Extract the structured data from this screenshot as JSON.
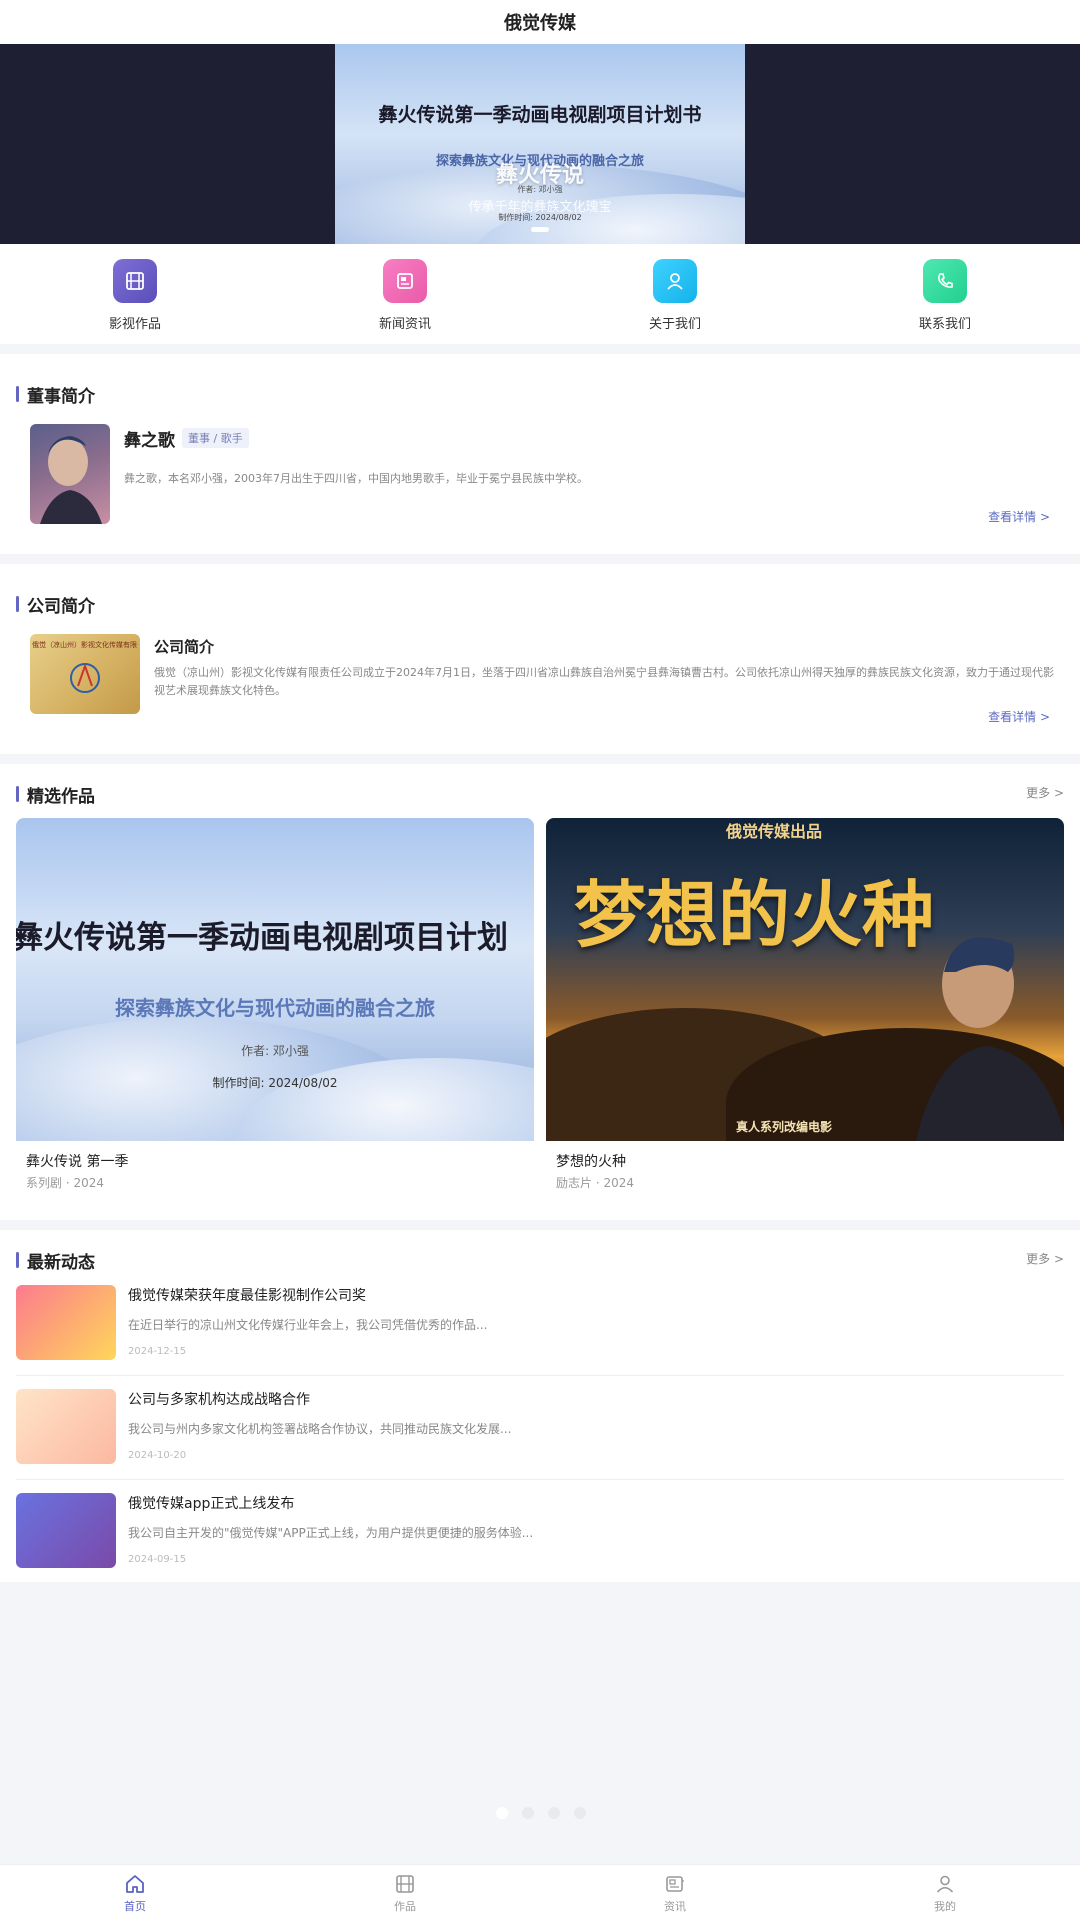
{
  "header": {
    "title": "俄觉传媒"
  },
  "banner": {
    "slide_title": "彝火传说第一季动画电视剧项目计划书",
    "slide_subtitle": "探索彝族文化与现代动画的融合之旅",
    "overlay_title": "彝火传说",
    "overlay_subtitle": "传承千年的彝族文化瑰宝",
    "author": "作者: 邓小强",
    "date": "制作时间: 2024/08/02"
  },
  "quicknav": [
    {
      "label": "影视作品",
      "icon": "film-icon",
      "color": "#6a5fc8"
    },
    {
      "label": "新闻资讯",
      "icon": "news-icon",
      "color": "#f06ab5"
    },
    {
      "label": "关于我们",
      "icon": "user-icon",
      "color": "#23c2f2"
    },
    {
      "label": "联系我们",
      "icon": "phone-icon",
      "color": "#35dca0"
    }
  ],
  "chairman": {
    "section_title": "董事简介",
    "name": "彝之歌",
    "tag": "董事 / 歌手",
    "bio": "彝之歌，本名邓小强，2003年7月出生于四川省，中国内地男歌手，毕业于冕宁县民族中学校。",
    "detail_link": "查看详情 >"
  },
  "company": {
    "section_title": "公司简介",
    "name": "公司简介",
    "logo_text": "俄觉（凉山州）影视文化传媒有限公司",
    "description": "俄觉（凉山州）影视文化传媒有限责任公司成立于2024年7月1日，坐落于四川省凉山彝族自治州冕宁县彝海镇曹古村。公司依托凉山州得天独厚的彝族民族文化资源，致力于通过现代影视艺术展现彝族文化特色。",
    "detail_link": "查看详情 >"
  },
  "works": {
    "section_title": "精选作品",
    "more": "更多 >",
    "items": [
      {
        "title": "彝火传说 第一季",
        "meta": "系列剧 · 2024",
        "poster_title": "彝火传说第一季动画电视剧项目计划",
        "poster_subtitle": "探索彝族文化与现代动画的融合之旅",
        "poster_author": "作者: 邓小强",
        "poster_date": "制作时间: 2024/08/02"
      },
      {
        "title": "梦想的火种",
        "meta": "励志片 · 2024",
        "poster_top": "俄觉传媒出品",
        "poster_title": "梦想的火种",
        "poster_bottom": "真人系列改编电影"
      }
    ]
  },
  "news": {
    "section_title": "最新动态",
    "more": "更多 >",
    "items": [
      {
        "title": "俄觉传媒荣获年度最佳影视制作公司奖",
        "desc": "在近日举行的凉山州文化传媒行业年会上，我公司凭借优秀的作品...",
        "date": "2024-12-15"
      },
      {
        "title": "公司与多家机构达成战略合作",
        "desc": "我公司与州内多家文化机构签署战略合作协议，共同推动民族文化发展...",
        "date": "2024-10-20"
      },
      {
        "title": "俄觉传媒app正式上线发布",
        "desc": "我公司自主开发的\"俄觉传媒\"APP正式上线，为用户提供更便捷的服务体验...",
        "date": "2024-09-15"
      }
    ]
  },
  "tabbar": [
    {
      "label": "首页",
      "icon": "home-icon",
      "active": true
    },
    {
      "label": "作品",
      "icon": "film-icon",
      "active": false
    },
    {
      "label": "资讯",
      "icon": "news-icon",
      "active": false
    },
    {
      "label": "我的",
      "icon": "user-icon",
      "active": false
    }
  ],
  "colors": {
    "accent": "#5a63c4",
    "banner_bg": "#1f1f33",
    "page_bg": "#f4f5f8"
  }
}
